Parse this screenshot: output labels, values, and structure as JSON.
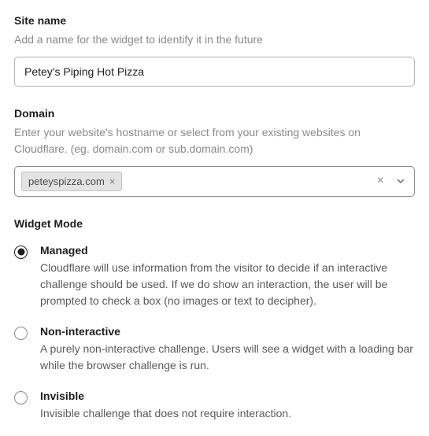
{
  "siteName": {
    "label": "Site name",
    "description": "Add a name for the widget to identify it in the future",
    "value": "Petey's Piping Hot Pizza"
  },
  "domain": {
    "label": "Domain",
    "description": "Enter your website's hostname or select from your existing websites on Cloudflare. (eg. domain.com or sub.domain.com)",
    "selected_tag": "peteyspizza.com"
  },
  "widgetMode": {
    "label": "Widget Mode",
    "options": [
      {
        "title": "Managed",
        "description": "Cloudflare will use information from the visitor to decide if an interactive challenge should be used. If we do show an interaction, the user will be prompted to check a box (no images or text to decipher).",
        "selected": true
      },
      {
        "title": "Non-interactive",
        "description": "A purely non-interactive challenge. Users will see a widget with a loading bar while the browser challenge is run.",
        "selected": false
      },
      {
        "title": "Invisible",
        "description": "Invisible challenge that does not require interaction.",
        "selected": false
      }
    ]
  }
}
